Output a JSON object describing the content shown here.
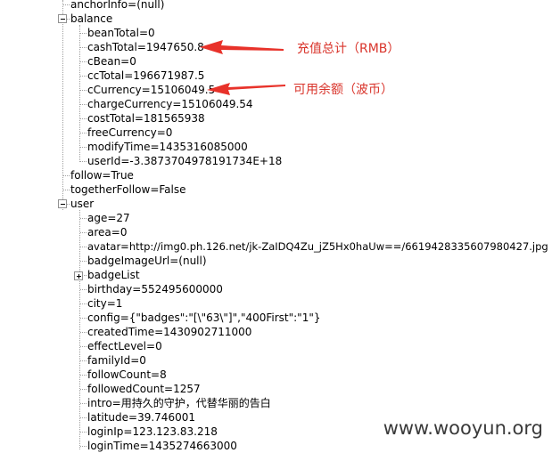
{
  "tree": {
    "anchorInfo": "anchorInfo=(null)",
    "balance": {
      "label": "balance",
      "items": [
        "beanTotal=0",
        "cashTotal=1947650.8",
        "cBean=0",
        "ccTotal=196671987.5",
        "cCurrency=15106049.5",
        "chargeCurrency=15106049.54",
        "costTotal=181565938",
        "freeCurrency=0",
        "modifyTime=1435316085000",
        "userId=-3.3873704978191734E+18"
      ]
    },
    "follow": "follow=True",
    "togetherFollow": "togetherFollow=False",
    "user": {
      "label": "user",
      "items": [
        "age=27",
        "area=0",
        "avatar=http://img0.ph.126.net/jk-ZaIDQ4Zu_jZ5Hx0haUw==/6619428335607980427.jpg",
        "badgeImageUrl=(null)",
        "badgeList",
        "birthday=552495600000",
        "city=1",
        "config={\"badges\":\"[\\\"63\\\"]\",\"400First\":\"1\"}",
        "createdTime=1430902711000",
        "effectLevel=0",
        "familyId=0",
        "followCount=8",
        "followedCount=1257",
        "intro=用持久的守护，代替华丽的告白",
        "latitude=39.746001",
        "loginIp=123.123.83.218",
        "loginTime=1435274663000"
      ]
    }
  },
  "annotations": {
    "cash_label": "充值总计（RMB）",
    "currency_label": "可用余额（波币）",
    "arrow_color": "#e8322a"
  },
  "watermark": "www.wooyun.org"
}
